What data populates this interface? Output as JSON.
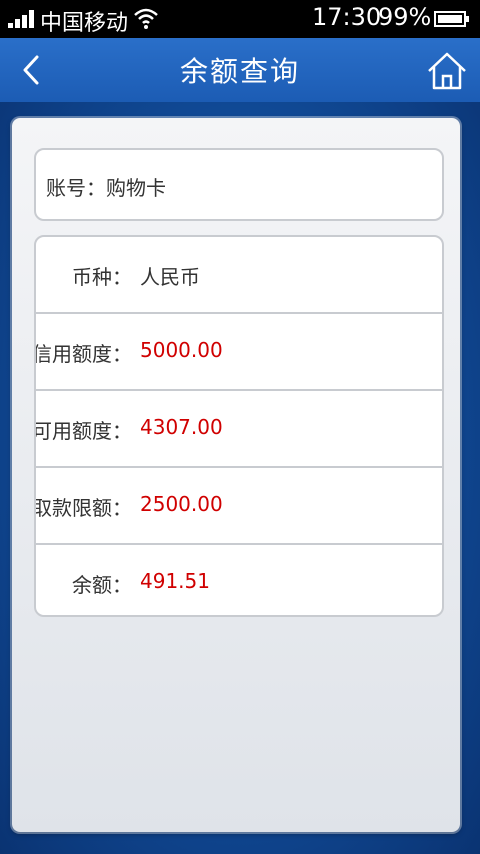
{
  "status_bar": {
    "carrier": "中国移动",
    "time": "17:30",
    "battery_percent": "99%",
    "battery_level": 0.99
  },
  "header": {
    "title": "余额查询",
    "back_icon": "chevron-left-icon",
    "home_icon": "home-icon"
  },
  "account": {
    "label": "账号：",
    "value": "购物卡"
  },
  "details": [
    {
      "label": "币种：",
      "value": "人民币"
    },
    {
      "label": "信用额度：",
      "value": "5000.00"
    },
    {
      "label": "可用额度：",
      "value": "4307.00"
    },
    {
      "label": "取款限额：",
      "value": "2500.00"
    },
    {
      "label": "余额：",
      "value": "491.51"
    }
  ],
  "colors": {
    "header": "#2a6fc9",
    "amount": "#d00000",
    "text": "#333333"
  }
}
